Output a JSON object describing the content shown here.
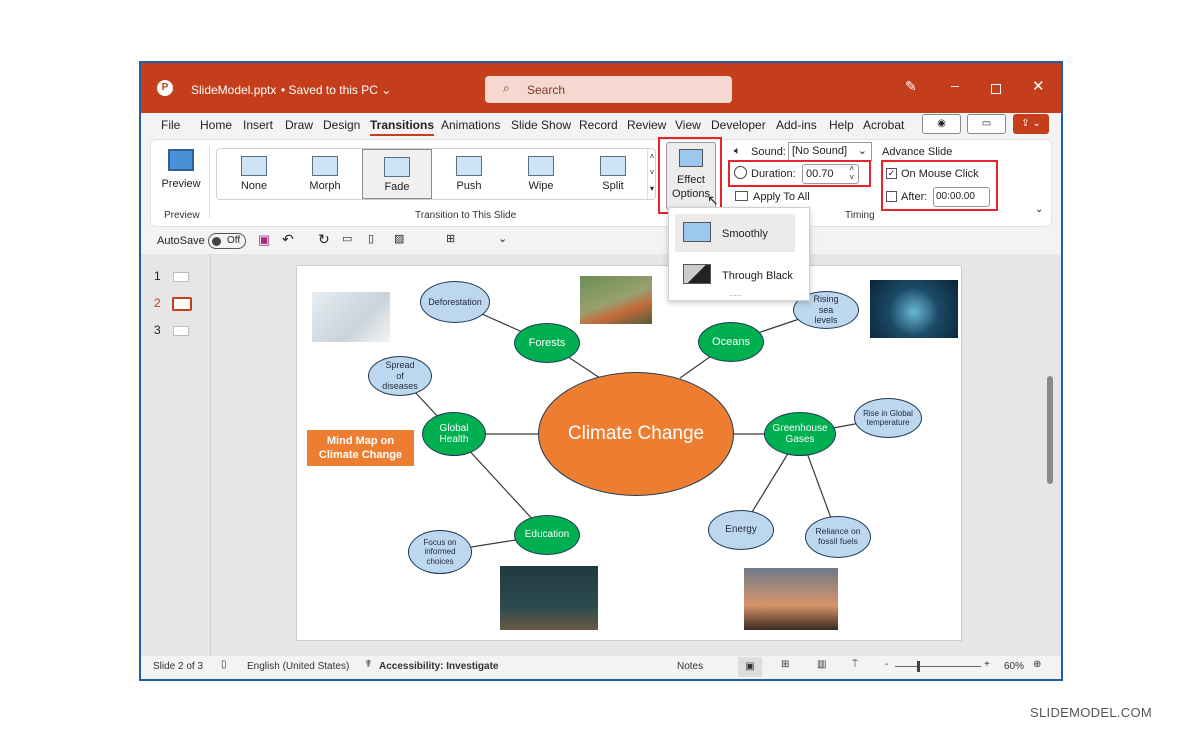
{
  "titlebar": {
    "filename": "SlideModel.pptx",
    "saved": "• Saved to this PC ⌄",
    "search_placeholder": "Search"
  },
  "tabs": [
    "File",
    "Home",
    "Insert",
    "Draw",
    "Design",
    "Transitions",
    "Animations",
    "Slide Show",
    "Record",
    "Review",
    "View",
    "Developer",
    "Add-ins",
    "Help",
    "Acrobat"
  ],
  "active_tab": "Transitions",
  "ribbon": {
    "preview": "Preview",
    "preview_group": "Preview",
    "transitions": [
      "None",
      "Morph",
      "Fade",
      "Push",
      "Wipe",
      "Split"
    ],
    "selected_transition": "Fade",
    "transition_group": "Transition to This Slide",
    "effect_options": "Effect",
    "effect_options2": "Options",
    "sound_label": "Sound:",
    "sound_value": "[No Sound]",
    "duration_label": "Duration:",
    "duration_value": "00.70",
    "apply_all": "Apply To All",
    "timing_group": "Timing",
    "advance_title": "Advance Slide",
    "on_click": "On Mouse Click",
    "on_click_checked": true,
    "after_label": "After:",
    "after_value": "00:00.00",
    "after_checked": false
  },
  "dropdown": {
    "items": [
      "Smoothly",
      "Through Black"
    ],
    "more": "....."
  },
  "qat": {
    "autosave": "AutoSave",
    "toggle": "Off"
  },
  "thumbnails": [
    "1",
    "2",
    "3"
  ],
  "current_slide": "2",
  "slide": {
    "center": "Climate Change",
    "title_box": "Mind Map on Climate Change",
    "nodes": {
      "forests": "Forests",
      "oceans": "Oceans",
      "health": "Global Health",
      "gases": "Greenhouse Gases",
      "education": "Education",
      "deforestation": "Deforestation",
      "diseases": "Spread of diseases",
      "choices": "Focus on informed choices",
      "sea": "Rising sea levels",
      "temp": "Rise in Global temperature",
      "energy": "Energy",
      "fossil": "Reliance on fossil fuels"
    },
    "colors": {
      "center": "#ed7d31",
      "primary": "#00b050",
      "secondary": "#bdd7ee"
    }
  },
  "status": {
    "slide": "Slide 2 of 3",
    "language": "English (United States)",
    "accessibility": "Accessibility: Investigate",
    "notes": "Notes",
    "zoom": "60%"
  },
  "watermark": "SLIDEMODEL.COM"
}
